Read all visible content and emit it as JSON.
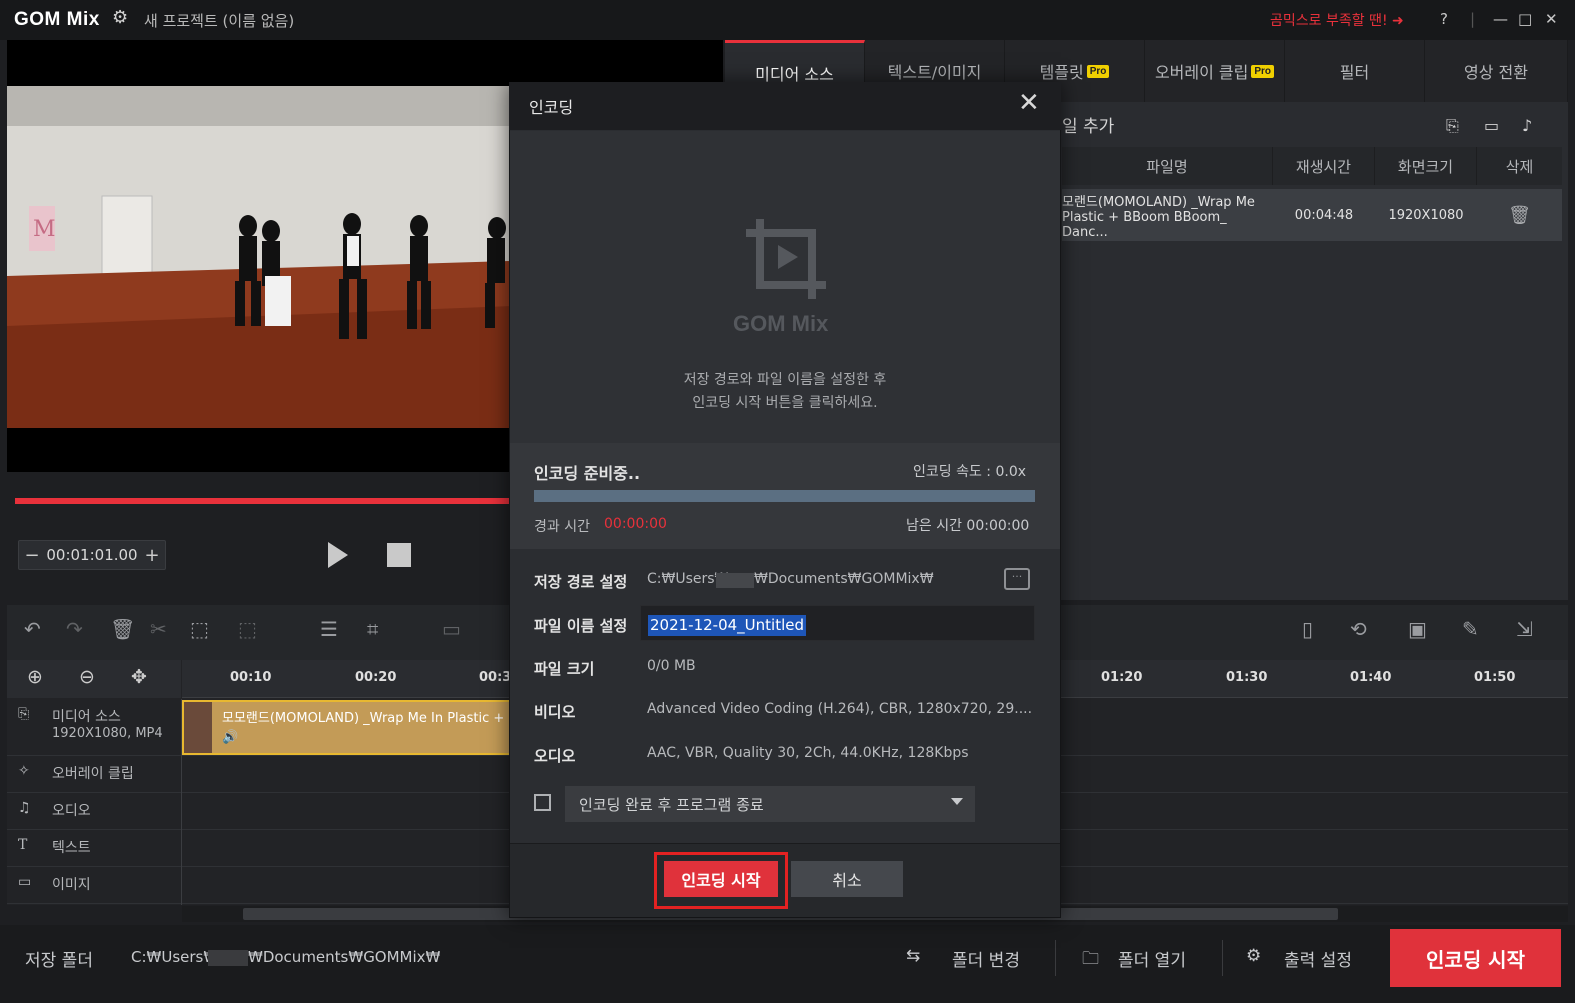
{
  "titlebar": {
    "app_name": "GOM Mix",
    "project_title": "새 프로젝트 (이름 없음)",
    "promo": "곰믹스로 부족할 땐! ➜",
    "help": "?",
    "min": "—",
    "max": "□",
    "close": "✕"
  },
  "player": {
    "time": "00:01:01.00",
    "minus": "−",
    "plus": "+"
  },
  "tabs": [
    {
      "label": "미디어 소스",
      "pro": false
    },
    {
      "label": "텍스트/이미지",
      "pro": false
    },
    {
      "label": "템플릿",
      "pro": true
    },
    {
      "label": "오버레이 클립",
      "pro": true
    },
    {
      "label": "필터",
      "pro": false
    },
    {
      "label": "영상 전환",
      "pro": false
    }
  ],
  "pro_badge": "Pro",
  "media": {
    "add_label": "일 추가",
    "columns": [
      "파일명",
      "재생시간",
      "화면크기",
      "삭제"
    ],
    "row": {
      "name_line1": "모랜드(MOMOLAND) _Wrap Me",
      "name_line2": "Plastic + BBoom BBoom_ Danc...",
      "duration": "00:04:48",
      "size": "1920X1080"
    }
  },
  "timeline": {
    "ticks": [
      "00:10",
      "00:20",
      "00:3",
      "01:20",
      "01:30",
      "01:40",
      "01:50"
    ],
    "tracks": [
      {
        "label": "미디어 소스",
        "sub": "1920X1080, MP4"
      },
      {
        "label": "오버레이 클립"
      },
      {
        "label": "오디오"
      },
      {
        "label": "텍스트"
      },
      {
        "label": "이미지"
      }
    ],
    "clip_label": "모모랜드(MOMOLAND) _Wrap Me In Plastic +"
  },
  "bottom": {
    "save_folder_label": "저장 폴더",
    "save_path_a": "C:₩Users₩",
    "save_path_b": "₩Documents₩GOMMix₩",
    "change_folder": "폴더 변경",
    "open_folder": "폴더 열기",
    "output_settings": "출력 설정",
    "start_encoding": "인코딩 시작"
  },
  "dialog": {
    "title": "인코딩",
    "logo_text": "GOM Mix",
    "instruction_line1": "저장 경로와 파일 이름을 설정한 후",
    "instruction_line2": "인코딩 시작 버튼을 클릭하세요.",
    "status": "인코딩 준비중..",
    "speed": "인코딩 속도 : 0.0x",
    "elapsed_label": "경과 시간",
    "elapsed_value": "00:00:00",
    "remaining": "남은 시간 00:00:00",
    "progress": 0,
    "path_label": "저장 경로 설정",
    "path_a": "C:₩Users₩",
    "path_b": "₩Documents₩GOMMix₩",
    "filename_label": "파일 이름 설정",
    "filename_value": "2021-12-04_Untitled",
    "filesize_label": "파일 크기",
    "filesize_value": "0/0 MB",
    "video_label": "비디오",
    "video_value": "Advanced Video Coding (H.264), CBR, 1280x720, 29....",
    "audio_label": "오디오",
    "audio_value": "AAC, VBR, Quality 30, 2Ch, 44.0KHz, 128Kbps",
    "after_option": "인코딩 완료 후 프로그램 종료",
    "start_button": "인코딩 시작",
    "cancel_button": "취소"
  },
  "colors": {
    "accent": "#e0323b",
    "selection": "#1e56b8",
    "clip": "#c39b57"
  }
}
